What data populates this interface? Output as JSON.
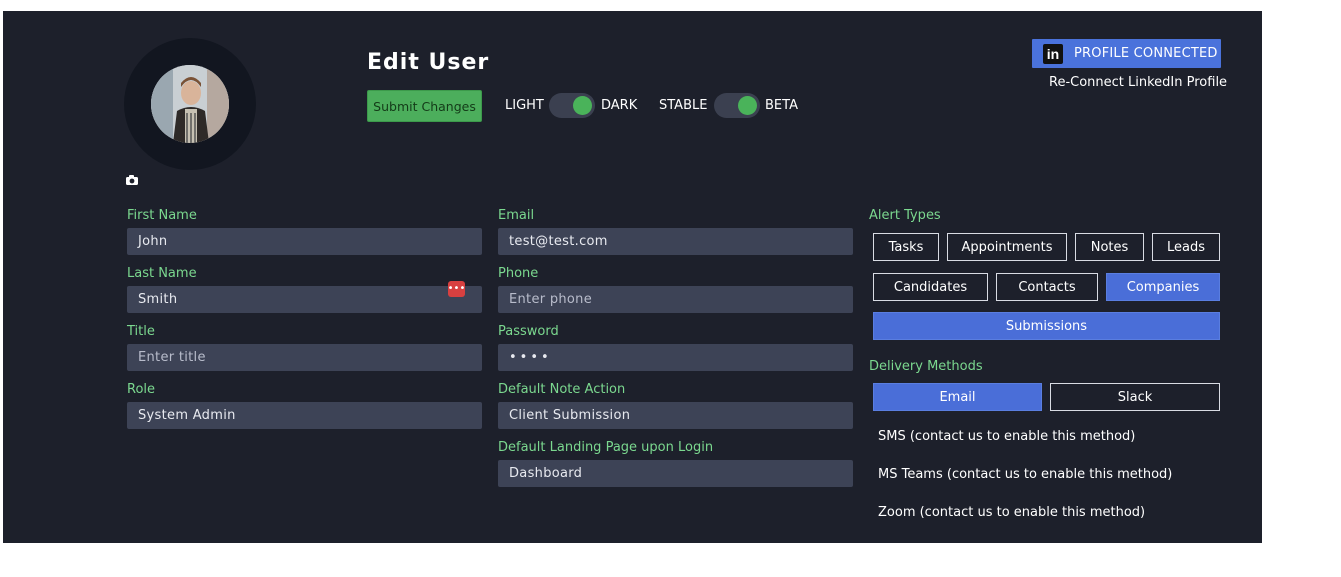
{
  "page": {
    "title": "Edit User"
  },
  "avatar": {
    "camera_icon": "camera-icon"
  },
  "actions": {
    "submit_label": "Submit Changes"
  },
  "toggles": {
    "theme": {
      "left": "LIGHT",
      "right": "DARK",
      "state": "DARK"
    },
    "channel": {
      "left": "STABLE",
      "right": "BETA",
      "state": "BETA"
    }
  },
  "linkedin": {
    "button_label": "PROFILE CONNECTED",
    "logo": "in",
    "reconnect_label": "Re-Connect LinkedIn Profile"
  },
  "fields": {
    "first_name": {
      "label": "First Name",
      "value": "John"
    },
    "last_name": {
      "label": "Last Name",
      "value": "Smith"
    },
    "title": {
      "label": "Title",
      "placeholder": "Enter title"
    },
    "role": {
      "label": "Role",
      "value": "System Admin"
    },
    "email": {
      "label": "Email",
      "value": "test@test.com"
    },
    "phone": {
      "label": "Phone",
      "placeholder": "Enter phone"
    },
    "password": {
      "label": "Password",
      "value": "••••"
    },
    "default_note_action": {
      "label": "Default Note Action",
      "value": "Client Submission"
    },
    "landing_page": {
      "label": "Default Landing Page upon Login",
      "value": "Dashboard"
    }
  },
  "alerts": {
    "label": "Alert Types",
    "items": [
      {
        "label": "Tasks",
        "active": false
      },
      {
        "label": "Appointments",
        "active": false
      },
      {
        "label": "Notes",
        "active": false
      },
      {
        "label": "Leads",
        "active": false
      },
      {
        "label": "Candidates",
        "active": false
      },
      {
        "label": "Contacts",
        "active": false
      },
      {
        "label": "Companies",
        "active": true
      },
      {
        "label": "Submissions",
        "active": true
      }
    ]
  },
  "delivery": {
    "label": "Delivery Methods",
    "methods": [
      {
        "label": "Email",
        "active": true
      },
      {
        "label": "Slack",
        "active": false
      }
    ],
    "disabled": [
      "SMS (contact us to enable this method)",
      "MS Teams (contact us to enable this method)",
      "Zoom (contact us to enable this method)"
    ]
  },
  "colors": {
    "background": "#1d202b",
    "accent": "#4a6ed8",
    "label": "#7bd88f",
    "submit": "#4cae5c",
    "input": "#3d4356"
  }
}
